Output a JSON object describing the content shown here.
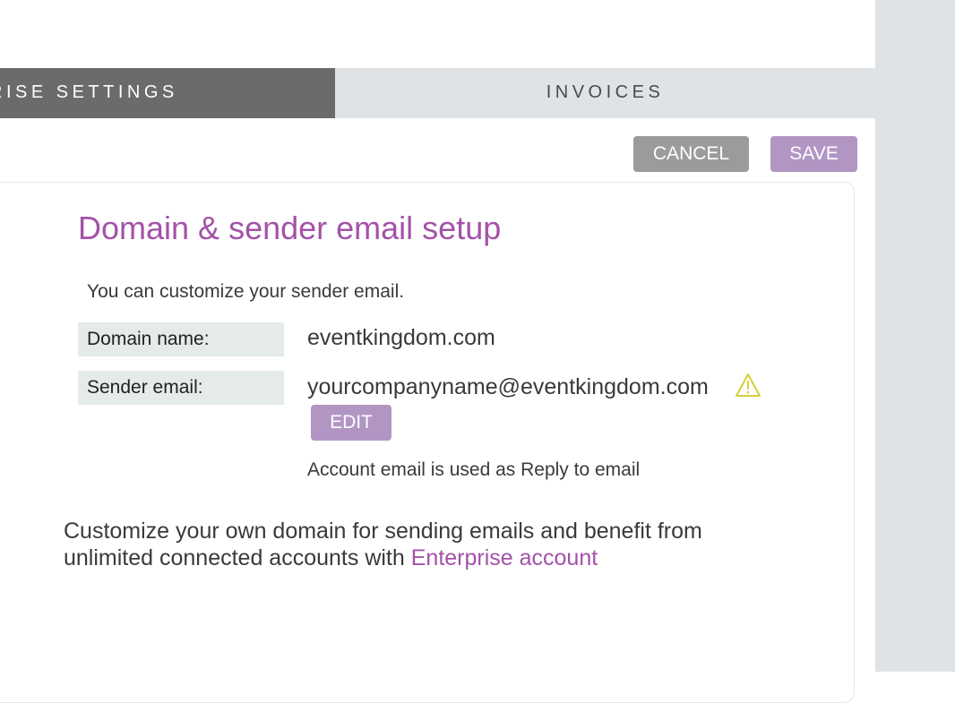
{
  "tabs": {
    "enterprise_settings": "RISE SETTINGS",
    "invoices": "INVOICES"
  },
  "actions": {
    "cancel_label": "CANCEL",
    "save_label": "SAVE"
  },
  "section": {
    "title": "Domain & sender email setup",
    "intro": "You can customize your sender email.",
    "domain_label": "Domain name:",
    "domain_value": "eventkingdom.com",
    "sender_label": "Sender email:",
    "sender_value": "yourcompanyname@eventkingdom.com",
    "edit_label": "EDIT",
    "note": "Account email is used as Reply to email",
    "promo_line1": "Customize your own domain for sending emails and benefit from",
    "promo_line2": "unlimited connected accounts with ",
    "promo_link": "Enterprise account"
  },
  "icons": {
    "warning": "warning-icon"
  },
  "colors": {
    "accent_purple": "#a352a8",
    "button_purple": "#b196c4",
    "button_gray": "#9b9b9b",
    "tab_active": "#6b6b6b",
    "tab_inactive": "#dfe3e6",
    "warning_yellow": "#d8cf3c"
  }
}
